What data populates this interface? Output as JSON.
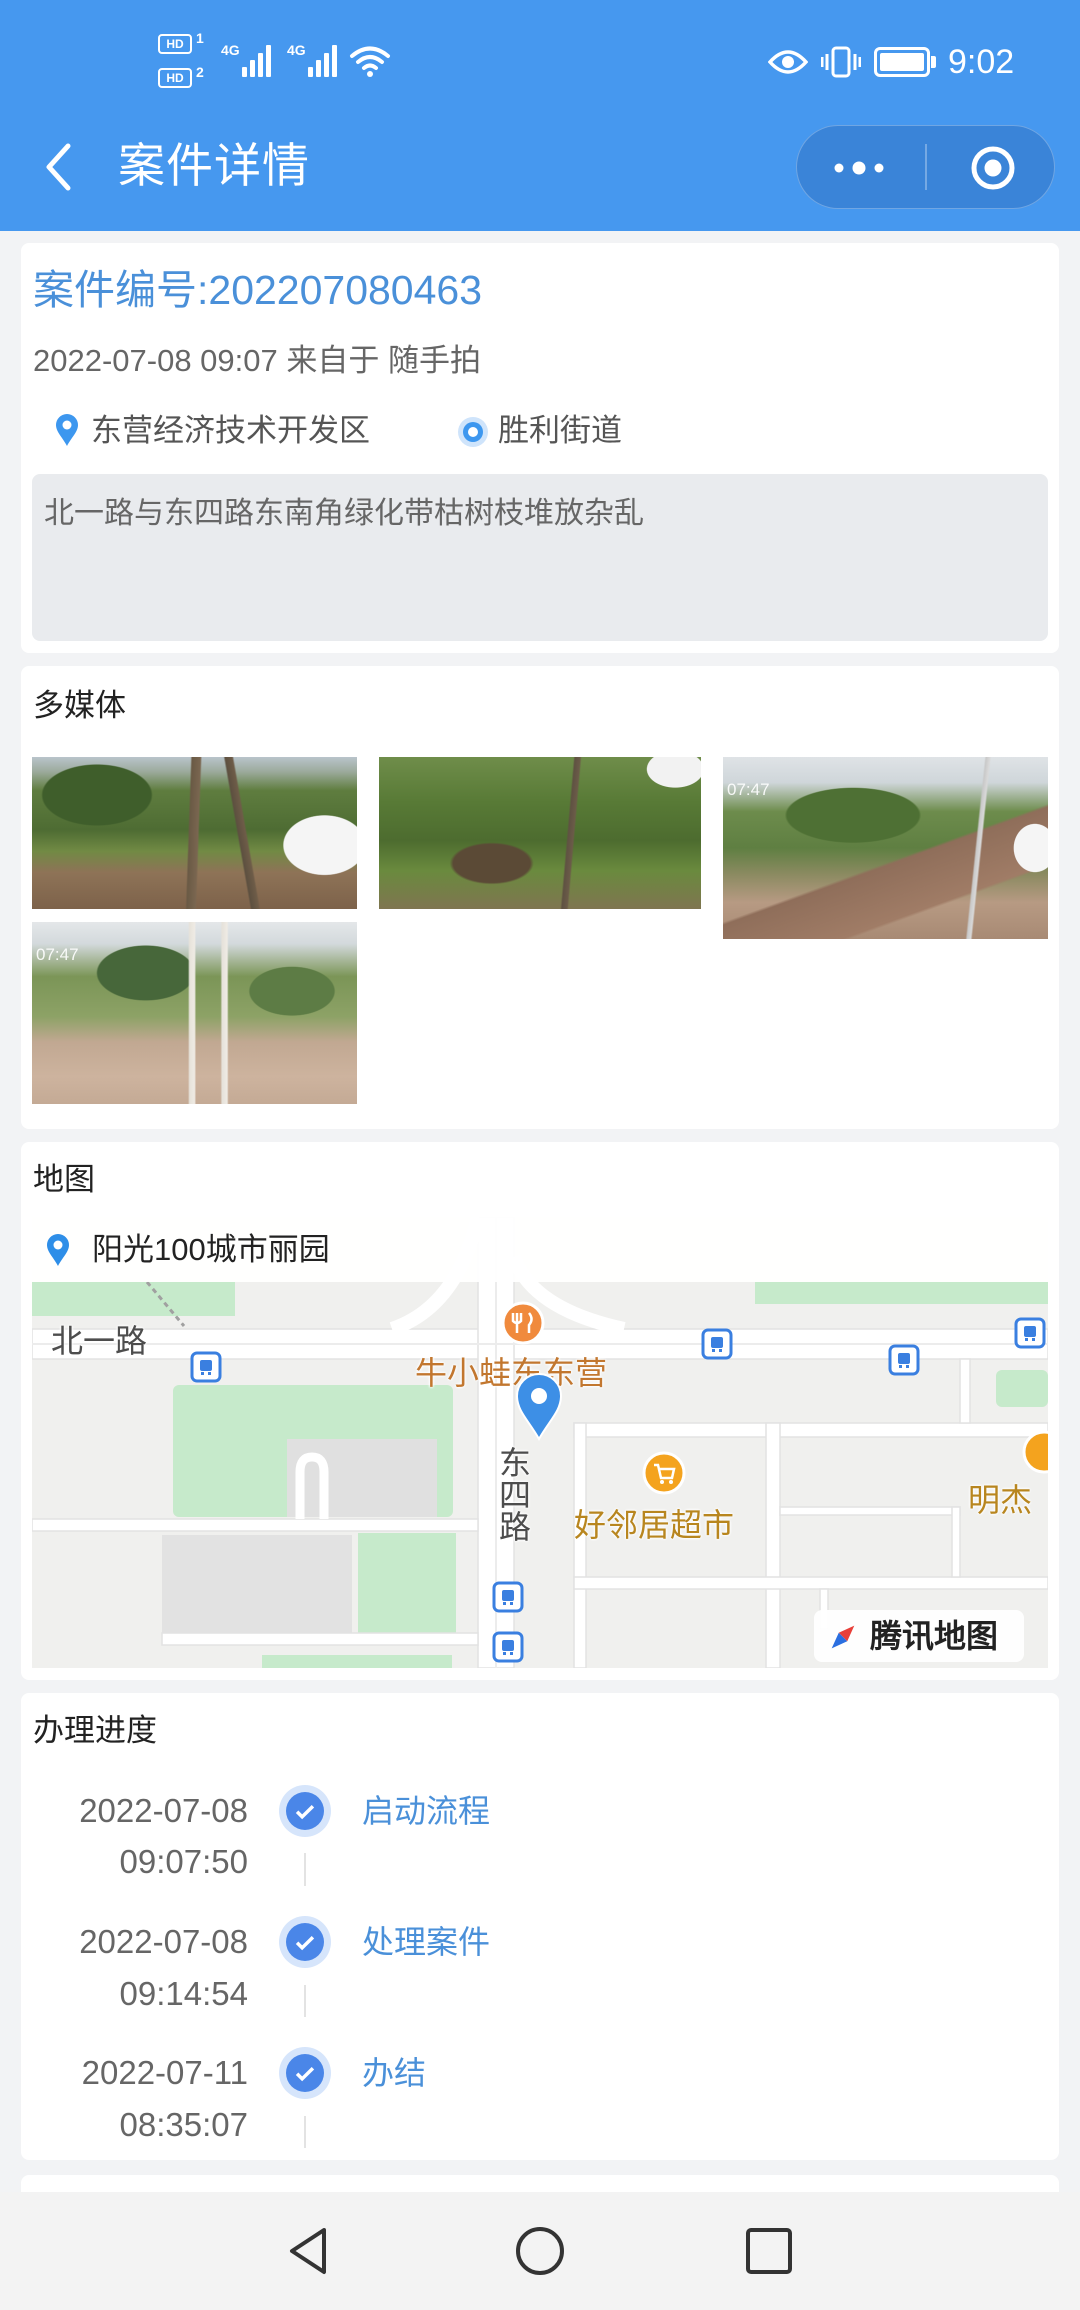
{
  "status_bar": {
    "sims": [
      {
        "badge": "HD",
        "index": "1"
      },
      {
        "badge": "HD",
        "index": "2"
      }
    ],
    "networks": [
      "4G",
      "4G"
    ],
    "time": "9:02",
    "icons": [
      "signal-icon",
      "wifi-icon",
      "eye-icon",
      "vibrate-icon",
      "battery-icon"
    ]
  },
  "header": {
    "title": "案件详情",
    "icons": [
      "chevron-left-icon",
      "more-dots-icon",
      "target-circle-icon"
    ]
  },
  "case": {
    "number_label": "案件编号:202207080463",
    "meta": "2022-07-08 09:07 来自于 随手拍",
    "district": "东营经济技术开发区",
    "street": "胜利街道",
    "description": "北一路与东四路东南角绿化带枯树枝堆放杂乱"
  },
  "media": {
    "title": "多媒体",
    "photos": [
      {
        "timestamp": ""
      },
      {
        "timestamp": ""
      },
      {
        "timestamp": "07:47"
      },
      {
        "timestamp": "07:47"
      }
    ]
  },
  "map": {
    "title": "地图",
    "location": "阳光100城市丽园",
    "labels": {
      "road_north": "北一路",
      "road_east": "东四路",
      "restaurant": "牛小蛙东东营",
      "supermarket": "好邻居超市",
      "shop_partial": "明杰"
    },
    "brand": "腾讯地图"
  },
  "progress": {
    "title": "办理进度",
    "steps": [
      {
        "date": "2022-07-08",
        "time": "09:07:50",
        "label": "启动流程"
      },
      {
        "date": "2022-07-08",
        "time": "09:14:54",
        "label": "处理案件"
      },
      {
        "date": "2022-07-11",
        "time": "08:35:07",
        "label": "办结"
      }
    ]
  },
  "nav_bar": {
    "icons": [
      "back-triangle-icon",
      "home-circle-icon",
      "recents-square-icon"
    ]
  },
  "colors": {
    "header": "#4698ef",
    "accent": "#4a90d9",
    "step_done": "#4a86e8",
    "page_bg": "#f2f3f5"
  }
}
